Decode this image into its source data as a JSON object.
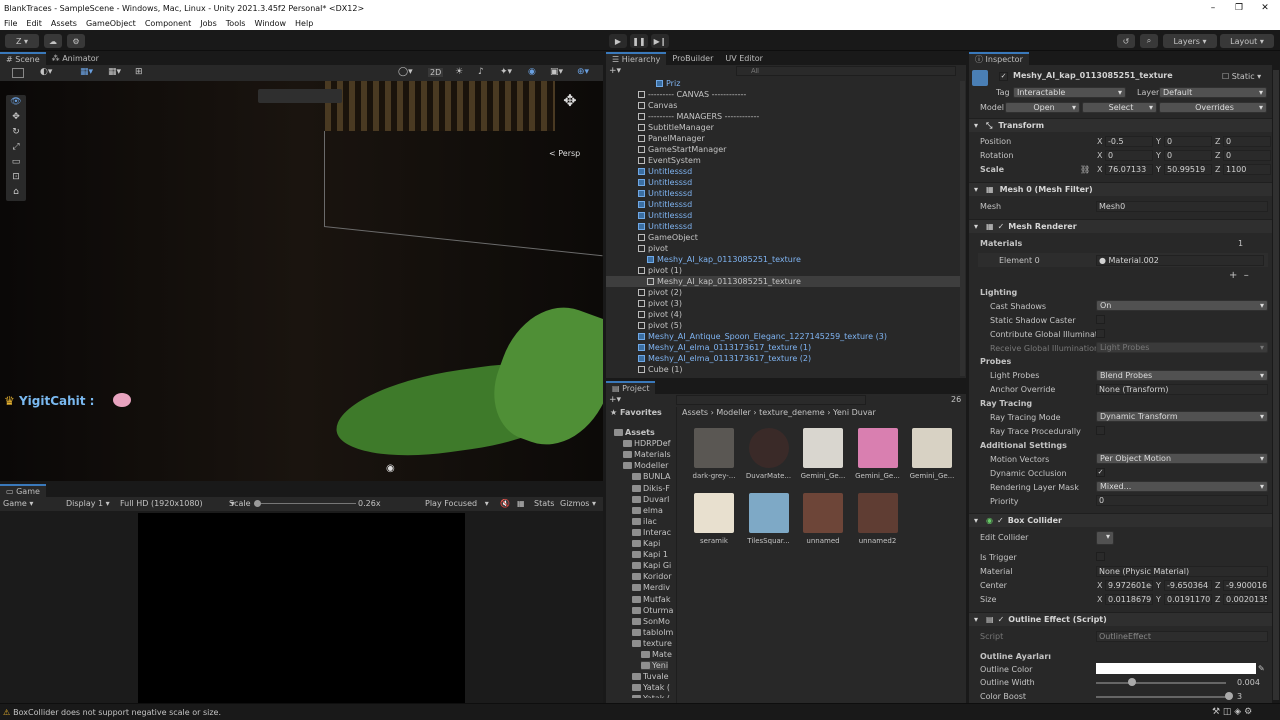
{
  "window": {
    "title": "BlankTraces - SampleScene - Windows, Mac, Linux - Unity 2021.3.45f2 Personal* <DX12>"
  },
  "menu": [
    "File",
    "Edit",
    "Assets",
    "GameObject",
    "Component",
    "Jobs",
    "Tools",
    "Window",
    "Help"
  ],
  "toolbar": {
    "account": "Z ▾",
    "layers": "Layers",
    "layout": "Layout"
  },
  "scene": {
    "tabs": [
      "Scene",
      "Animator"
    ],
    "mode_2d": "2D",
    "persp": "< Persp",
    "user_label": "YigitCahit :"
  },
  "game": {
    "tab": "Game",
    "view": "Game",
    "display": "Display 1",
    "resolution": "Full HD (1920x1080)",
    "scale_label": "Scale",
    "scale_value": "0.26x",
    "play_mode": "Play Focused",
    "stats": "Stats",
    "gizmos": "Gizmos"
  },
  "hierarchy": {
    "tabs": [
      "Hierarchy",
      "ProBuilder",
      "UV Editor"
    ],
    "search_placeholder": "All",
    "items": [
      {
        "name": "Priz",
        "blue": true,
        "indent": 2
      },
      {
        "name": "--------- CANVAS ------------",
        "blue": false,
        "indent": 0
      },
      {
        "name": "Canvas",
        "blue": false,
        "indent": 0
      },
      {
        "name": "--------- MANAGERS ------------",
        "blue": false,
        "indent": 0
      },
      {
        "name": "SubtitleManager",
        "blue": false,
        "indent": 0
      },
      {
        "name": "PanelManager",
        "blue": false,
        "indent": 0
      },
      {
        "name": "GameStartManager",
        "blue": false,
        "indent": 0
      },
      {
        "name": "EventSystem",
        "blue": false,
        "indent": 0
      },
      {
        "name": "Untitlesssd",
        "blue": true,
        "indent": 0
      },
      {
        "name": "Untitlesssd",
        "blue": true,
        "indent": 0
      },
      {
        "name": "Untitlesssd",
        "blue": true,
        "indent": 0
      },
      {
        "name": "Untitlesssd",
        "blue": true,
        "indent": 0
      },
      {
        "name": "Untitlesssd",
        "blue": true,
        "indent": 0
      },
      {
        "name": "Untitlesssd",
        "blue": true,
        "indent": 0
      },
      {
        "name": "GameObject",
        "blue": false,
        "indent": 0
      },
      {
        "name": "pivot",
        "blue": false,
        "indent": 0
      },
      {
        "name": "Meshy_AI_kap_0113085251_texture",
        "blue": true,
        "indent": 1
      },
      {
        "name": "pivot (1)",
        "blue": false,
        "indent": 0
      },
      {
        "name": "Meshy_AI_kap_0113085251_texture",
        "blue": false,
        "indent": 1,
        "selected": true
      },
      {
        "name": "pivot (2)",
        "blue": false,
        "indent": 0
      },
      {
        "name": "pivot (3)",
        "blue": false,
        "indent": 0
      },
      {
        "name": "pivot (4)",
        "blue": false,
        "indent": 0
      },
      {
        "name": "pivot (5)",
        "blue": false,
        "indent": 0
      },
      {
        "name": "Meshy_AI_Antique_Spoon_Eleganc_1227145259_texture (3)",
        "blue": true,
        "indent": 0
      },
      {
        "name": "Meshy_AI_elma_0113173617_texture (1)",
        "blue": true,
        "indent": 0
      },
      {
        "name": "Meshy_AI_elma_0113173617_texture (2)",
        "blue": true,
        "indent": 0
      },
      {
        "name": "Cube (1)",
        "blue": false,
        "indent": 0
      }
    ]
  },
  "project": {
    "tab": "Project",
    "count": "26",
    "favorites": "Favorites",
    "breadcrumb": [
      "Assets",
      "Modeller",
      "texture_deneme",
      "Yeni Duvar"
    ],
    "tree": [
      {
        "name": "Assets",
        "level": 0,
        "bold": true
      },
      {
        "name": "HDRPDef",
        "level": 1
      },
      {
        "name": "Materials",
        "level": 1
      },
      {
        "name": "Modeller",
        "level": 1
      },
      {
        "name": "BUNLA",
        "level": 2
      },
      {
        "name": "Dikis-F",
        "level": 2
      },
      {
        "name": "Duvarl",
        "level": 2
      },
      {
        "name": "elma",
        "level": 2
      },
      {
        "name": "ilac",
        "level": 2
      },
      {
        "name": "Interac",
        "level": 2
      },
      {
        "name": "Kapi",
        "level": 2
      },
      {
        "name": "Kapi 1",
        "level": 2
      },
      {
        "name": "Kapi Gi",
        "level": 2
      },
      {
        "name": "Koridor",
        "level": 2
      },
      {
        "name": "Merdiv",
        "level": 2
      },
      {
        "name": "Mutfak",
        "level": 2
      },
      {
        "name": "Oturma",
        "level": 2
      },
      {
        "name": "SonMo",
        "level": 2
      },
      {
        "name": "tablolm",
        "level": 2
      },
      {
        "name": "texture",
        "level": 2
      },
      {
        "name": "Mate",
        "level": 3
      },
      {
        "name": "Yeni",
        "level": 3,
        "selected": true
      },
      {
        "name": "Tuvale",
        "level": 2
      },
      {
        "name": "Yatak (",
        "level": 2
      },
      {
        "name": "Yatak (",
        "level": 2
      }
    ],
    "assets": [
      {
        "label": "dark-grey-...",
        "color": "#5a5753"
      },
      {
        "label": "DuvarMate...",
        "color": "#3a2a28"
      },
      {
        "label": "Gemini_Ge...",
        "color": "#d9d6cf"
      },
      {
        "label": "Gemini_Ge...",
        "color": "#d97fb0"
      },
      {
        "label": "Gemini_Ge...",
        "color": "#d8d2c4"
      },
      {
        "label": "seramik",
        "color": "#e8e0cf"
      },
      {
        "label": "TilesSquar...",
        "color": "#7ea9c6"
      },
      {
        "label": "unnamed",
        "color": "#6d4538"
      },
      {
        "label": "unnamed2",
        "color": "#5f3d33"
      }
    ]
  },
  "inspector": {
    "tab": "Inspector",
    "object_name": "Meshy_AI_kap_0113085251_texture",
    "static": "Static",
    "tag_label": "Tag",
    "tag": "Interactable",
    "layer_label": "Layer",
    "layer": "Default",
    "model_label": "Model",
    "open": "Open",
    "select": "Select",
    "overrides": "Overrides",
    "transform": {
      "title": "Transform",
      "position_label": "Position",
      "rotation_label": "Rotation",
      "scale_label": "Scale",
      "position": {
        "x": "-0.5",
        "y": "0",
        "z": "0"
      },
      "rotation": {
        "x": "0",
        "y": "0",
        "z": "0"
      },
      "scale": {
        "x": "76.07133",
        "y": "50.99519",
        "z": "1100"
      }
    },
    "mesh_filter": {
      "title": "Mesh 0 (Mesh Filter)",
      "mesh_label": "Mesh",
      "mesh": "Mesh0"
    },
    "mesh_renderer": {
      "title": "Mesh Renderer",
      "materials_label": "Materials",
      "materials_count": "1",
      "element0_label": "Element 0",
      "element0": "Material.002",
      "lighting": "Lighting",
      "cast_shadows_label": "Cast Shadows",
      "cast_shadows": "On",
      "static_shadow_caster": "Static Shadow Caster",
      "contribute_gi": "Contribute Global Illuminati",
      "receive_gi": "Receive Global Illumination",
      "receive_gi_value": "Light Probes",
      "probes": "Probes",
      "light_probes_label": "Light Probes",
      "light_probes": "Blend Probes",
      "anchor_override_label": "Anchor Override",
      "anchor_override": "None (Transform)",
      "ray_tracing": "Ray Tracing",
      "ray_tracing_mode_label": "Ray Tracing Mode",
      "ray_tracing_mode": "Dynamic Transform",
      "ray_trace_procedurally": "Ray Trace Procedurally",
      "additional": "Additional Settings",
      "motion_vectors_label": "Motion Vectors",
      "motion_vectors": "Per Object Motion",
      "dynamic_occlusion": "Dynamic Occlusion",
      "rendering_layer_mask_label": "Rendering Layer Mask",
      "rendering_layer_mask": "Mixed...",
      "priority_label": "Priority",
      "priority": "0"
    },
    "box_collider": {
      "title": "Box Collider",
      "edit_collider": "Edit Collider",
      "is_trigger": "Is Trigger",
      "material_label": "Material",
      "material": "None (Physic Material)",
      "center_label": "Center",
      "size_label": "Size",
      "center": {
        "x": "9.972601e-",
        "y": "-9.650364",
        "z": "-9.900016"
      },
      "size": {
        "x": "0.0118679",
        "y": "0.0191170",
        "z": "0.0020135"
      }
    },
    "outline": {
      "title": "Outline Effect (Script)",
      "script_label": "Script",
      "script": "OutlineEffect",
      "settings_title": "Outline Ayarları",
      "color_label": "Outline Color",
      "width_label": "Outline Width",
      "width": "0.004",
      "boost_label": "Color Boost",
      "boost": "3"
    }
  },
  "status": {
    "message": "BoxCollider does not support negative scale or size."
  }
}
